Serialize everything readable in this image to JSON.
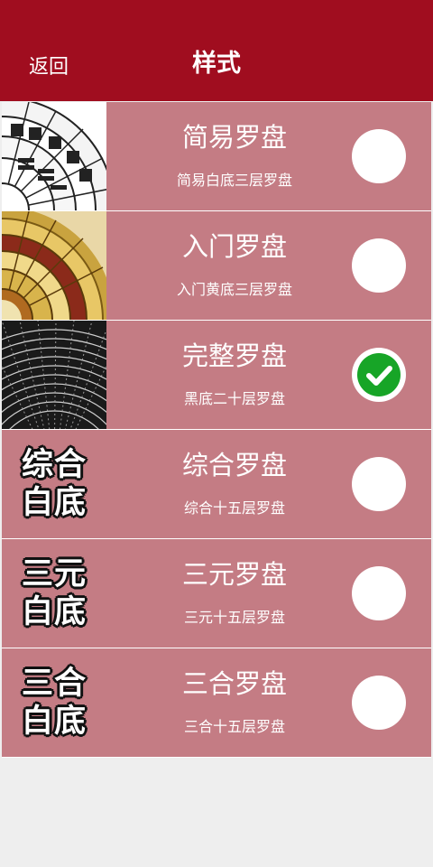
{
  "header": {
    "back_label": "返回",
    "title": "样式"
  },
  "colors": {
    "header_bg": "#a00d1f",
    "row_bg": "#c47c84",
    "selected_check": "#17a527"
  },
  "styles": [
    {
      "name": "简易罗盘",
      "desc": "简易白底三层罗盘",
      "thumb": "white-compass-image",
      "selected": false
    },
    {
      "name": "入门罗盘",
      "desc": "入门黄底三层罗盘",
      "thumb": "yellow-compass-image",
      "selected": false
    },
    {
      "name": "完整罗盘",
      "desc": "黑底二十层罗盘",
      "thumb": "black-compass-image",
      "selected": true
    },
    {
      "name": "综合罗盘",
      "desc": "综合十五层罗盘",
      "thumb_lines": [
        "综合",
        "白底"
      ],
      "selected": false
    },
    {
      "name": "三元罗盘",
      "desc": "三元十五层罗盘",
      "thumb_lines": [
        "三元",
        "白底"
      ],
      "selected": false
    },
    {
      "name": "三合罗盘",
      "desc": "三合十五层罗盘",
      "thumb_lines": [
        "三合",
        "白底"
      ],
      "selected": false
    }
  ]
}
